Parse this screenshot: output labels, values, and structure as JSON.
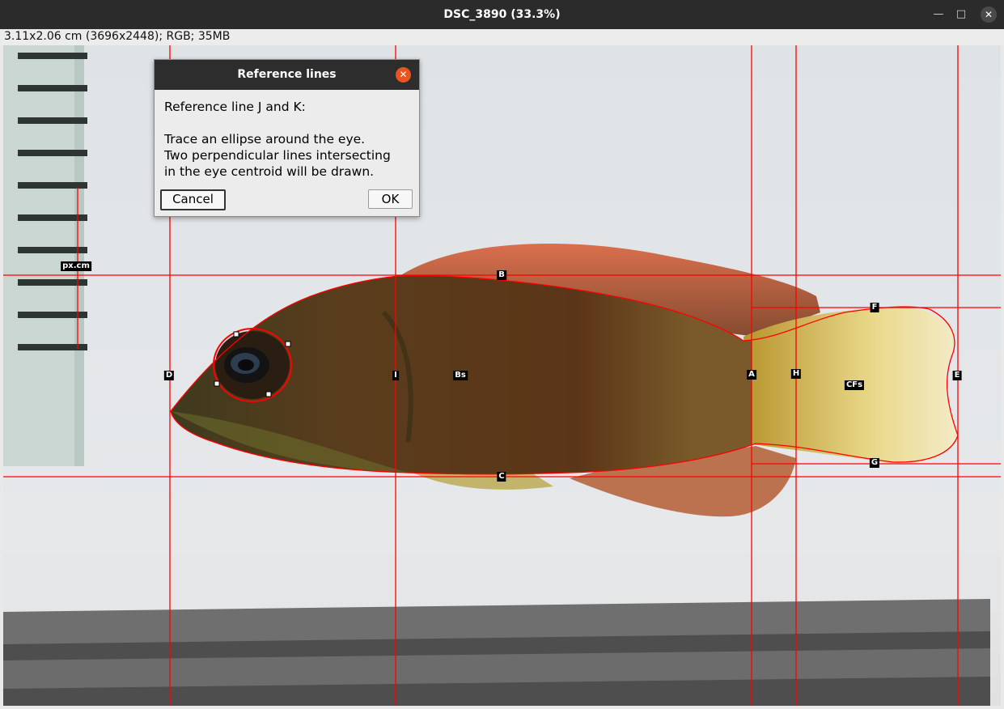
{
  "window": {
    "title": "DSC_3890 (33.3%)",
    "minimize_glyph": "—",
    "maximize_glyph": "□",
    "close_glyph": "✕"
  },
  "image_info": "3.11x2.06 cm (3696x2448); RGB; 35MB",
  "overlay": {
    "line_color": "#ff0000",
    "labels": {
      "scale": "px.cm",
      "B": "B",
      "C": "C",
      "D": "D",
      "I": "I",
      "Bs": "Bs",
      "A": "A",
      "H": "H",
      "CFs": "CFs",
      "E": "E",
      "F": "F",
      "G": "G"
    }
  },
  "dialog": {
    "title": "Reference lines",
    "heading": "Reference line J and K:",
    "lines": [
      "Trace an ellipse around the eye.",
      "Two perpendicular lines intersecting",
      "in the eye centroid will be drawn."
    ],
    "cancel_label": "Cancel",
    "ok_label": "OK",
    "close_glyph": "✕"
  },
  "colors": {
    "titlebar": "#2b2b2b",
    "dialog_close": "#e95420",
    "annotation": "#ff0000"
  }
}
